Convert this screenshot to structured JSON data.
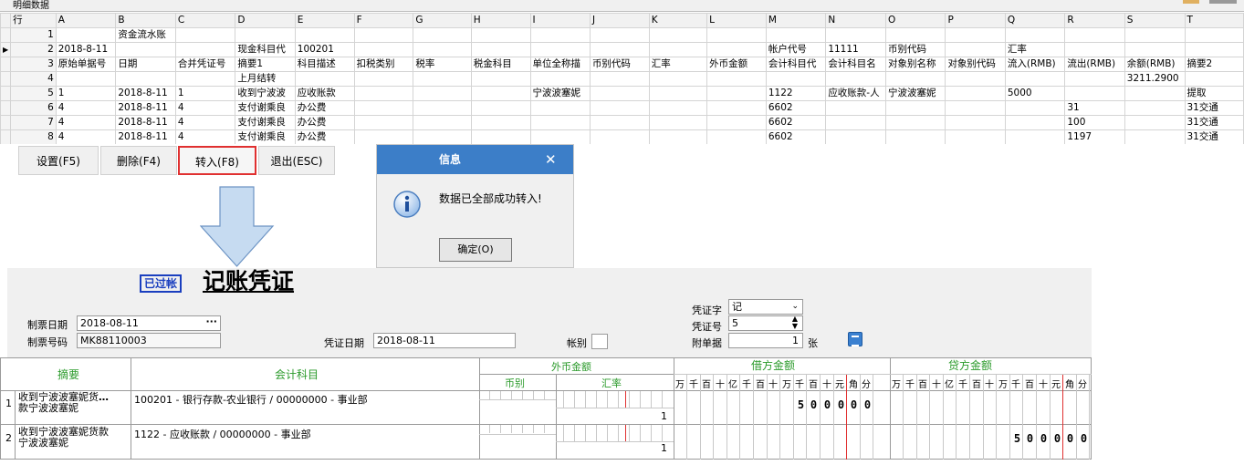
{
  "window": {
    "title": "明细数据"
  },
  "sheet": {
    "columns": [
      "行",
      "A",
      "B",
      "C",
      "D",
      "E",
      "F",
      "G",
      "H",
      "I",
      "J",
      "K",
      "L",
      "M",
      "N",
      "O",
      "P",
      "Q",
      "R",
      "S",
      "T"
    ],
    "rows": [
      [
        "",
        "1",
        "",
        "资金流水账",
        "",
        "",
        "",
        "",
        "",
        "",
        "",
        "",
        "",
        "",
        "",
        "",
        "",
        "",
        "",
        "",
        "",
        ""
      ],
      [
        "▶",
        "2",
        "2018-8-11",
        "",
        "",
        "现金科目代",
        "100201",
        "",
        "",
        "",
        "",
        "",
        "",
        "",
        "帐户代号",
        "11111",
        "币别代码",
        "",
        "汇率",
        "",
        "",
        ""
      ],
      [
        "",
        "3",
        "原始单据号",
        "日期",
        "合并凭证号",
        "摘要1",
        "科目描述",
        "扣税类别",
        "税率",
        "税金科目",
        "单位全称描",
        "币别代码",
        "汇率",
        "外币金额",
        "会计科目代",
        "会计科目名",
        "对象别名称",
        "对象别代码",
        "流入(RMB)",
        "流出(RMB)",
        "余额(RMB)",
        "摘要2"
      ],
      [
        "",
        "4",
        "",
        "",
        "",
        "上月结转",
        "",
        "",
        "",
        "",
        "",
        "",
        "",
        "",
        "",
        "",
        "",
        "",
        "",
        "",
        "3211.2900",
        ""
      ],
      [
        "",
        "5",
        "1",
        "2018-8-11",
        "1",
        "收到宁波波",
        "应收账款",
        "",
        "",
        "",
        "宁波波塞妮",
        "",
        "",
        "",
        "1122",
        "应收账款-人",
        "宁波波塞妮",
        "",
        "5000",
        "",
        "",
        "提取"
      ],
      [
        "",
        "6",
        "4",
        "2018-8-11",
        "4",
        "支付谢乘良",
        "办公费",
        "",
        "",
        "",
        "",
        "",
        "",
        "",
        "6602",
        "",
        "",
        "",
        "",
        "31",
        "",
        "31交通"
      ],
      [
        "",
        "7",
        "4",
        "2018-8-11",
        "4",
        "支付谢乘良",
        "办公费",
        "",
        "",
        "",
        "",
        "",
        "",
        "",
        "6602",
        "",
        "",
        "",
        "",
        "100",
        "",
        "31交通"
      ],
      [
        "",
        "8",
        "4",
        "2018-8-11",
        "4",
        "支付谢乘良",
        "办公费",
        "",
        "",
        "",
        "",
        "",
        "",
        "",
        "6602",
        "",
        "",
        "",
        "",
        "1197",
        "",
        "31交通"
      ]
    ]
  },
  "toolbar": {
    "settings": "设置(F5)",
    "delete": "删除(F4)",
    "import": "转入(F8)",
    "exit": "退出(ESC)"
  },
  "dialog": {
    "title": "信息",
    "close": "✕",
    "message": "数据已全部成功转入!",
    "ok": "确定(O)"
  },
  "voucher": {
    "posted_badge": "已过帐",
    "title": "记账凭证",
    "make_date_label": "制票日期",
    "make_date": "2018-08-11",
    "make_no_label": "制票号码",
    "make_no": "MK88110003",
    "voucher_date_label": "凭证日期",
    "voucher_date": "2018-08-11",
    "book_label": "帐别",
    "word_label": "凭证字",
    "word": "记",
    "no_label": "凭证号",
    "no": "5",
    "attach_label": "附单据",
    "attach": "1",
    "attach_unit": "张"
  },
  "entries": {
    "headers": {
      "summary": "摘要",
      "account": "会计科目",
      "foreign": "外币金额",
      "currency": "币别",
      "rate": "汇率",
      "debit": "借方金额",
      "credit": "贷方金额",
      "units": [
        "万",
        "千",
        "百",
        "十",
        "亿",
        "千",
        "百",
        "十",
        "万",
        "千",
        "百",
        "十",
        "元",
        "角",
        "分"
      ]
    },
    "rows": [
      {
        "no": "1",
        "summary": "收到宁波波塞妮货款宁波波塞妮",
        "summary_l1": "收到宁波波塞妮货",
        "summary_l2": "款宁波波塞妮",
        "account": "100201 - 银行存款-农业银行 / 00000000 - 事业部",
        "rate": "1",
        "debit_digits": [
          "5",
          "0",
          "0",
          "0",
          "0",
          "0"
        ],
        "credit_digits": []
      },
      {
        "no": "2",
        "summary": "收到宁波波塞妮货款宁波波塞妮",
        "summary_l1": "收到宁波波塞妮货款",
        "summary_l2": "宁波波塞妮",
        "account": "1122 - 应收账款 / 00000000 - 事业部",
        "rate": "1",
        "debit_digits": [],
        "credit_digits": [
          "5",
          "0",
          "0",
          "0",
          "0",
          "0"
        ]
      }
    ]
  },
  "colors": {
    "dialog_header": "#3c7ec8",
    "highlight_border": "#e03030",
    "accent_green": "#2a9a2a",
    "badge_blue": "#1a3fbf",
    "red_line": "#e03030"
  }
}
